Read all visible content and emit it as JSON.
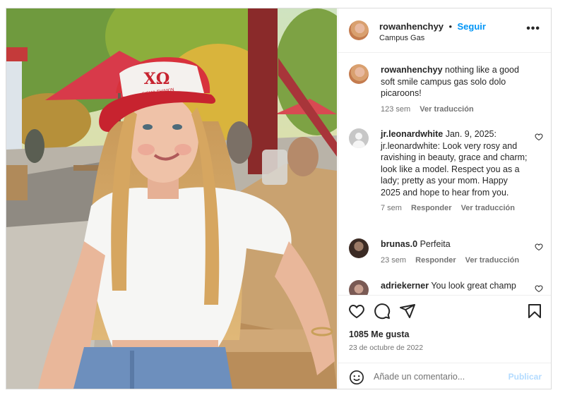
{
  "post": {
    "author": "rowanhenchyy",
    "separator": "•",
    "follow_label": "Seguir",
    "location": "Campus Gas",
    "more_label": "•••",
    "cap_text": "ΧΩ",
    "cap_subtext": "SIGMA THINKIN"
  },
  "comments": [
    {
      "user": "rowanhenchyy",
      "text": "nothing like a good soft smile campus gas solo dolo picaroons!",
      "time": "123 sem",
      "reply": "",
      "translate": "Ver traducción",
      "avatar": "user-photo"
    },
    {
      "user": "jr.leonardwhite",
      "text": "Jan. 9, 2025: jr.leonardwhite: Look very rosy and ravishing in beauty, grace and charm; look like a model. Respect you as a lady; pretty as your mom. Happy 2025 and hope to hear from you.",
      "time": "7 sem",
      "reply": "Responder",
      "translate": "Ver traducción",
      "avatar": "default-avatar"
    },
    {
      "user": "brunas.0",
      "text": "Perfeita",
      "time": "23 sem",
      "reply": "Responder",
      "translate": "Ver traducción",
      "avatar": "user-photo"
    },
    {
      "user": "adriekerner",
      "text": "You look great champ",
      "time": "",
      "reply": "",
      "translate": "",
      "avatar": "user-photo"
    }
  ],
  "actions": {
    "likes": "1085 Me gusta",
    "date": "23 de octubre de 2022"
  },
  "add_comment": {
    "placeholder": "Añade un comentario...",
    "publish": "Publicar"
  },
  "colors": {
    "link": "#0095f6",
    "muted": "#737373",
    "publish_disabled": "#b3dbff",
    "cap": "#d8323c"
  },
  "icons": [
    "heart-icon",
    "comment-icon",
    "share-icon",
    "bookmark-icon",
    "emoji-icon",
    "more-icon"
  ]
}
